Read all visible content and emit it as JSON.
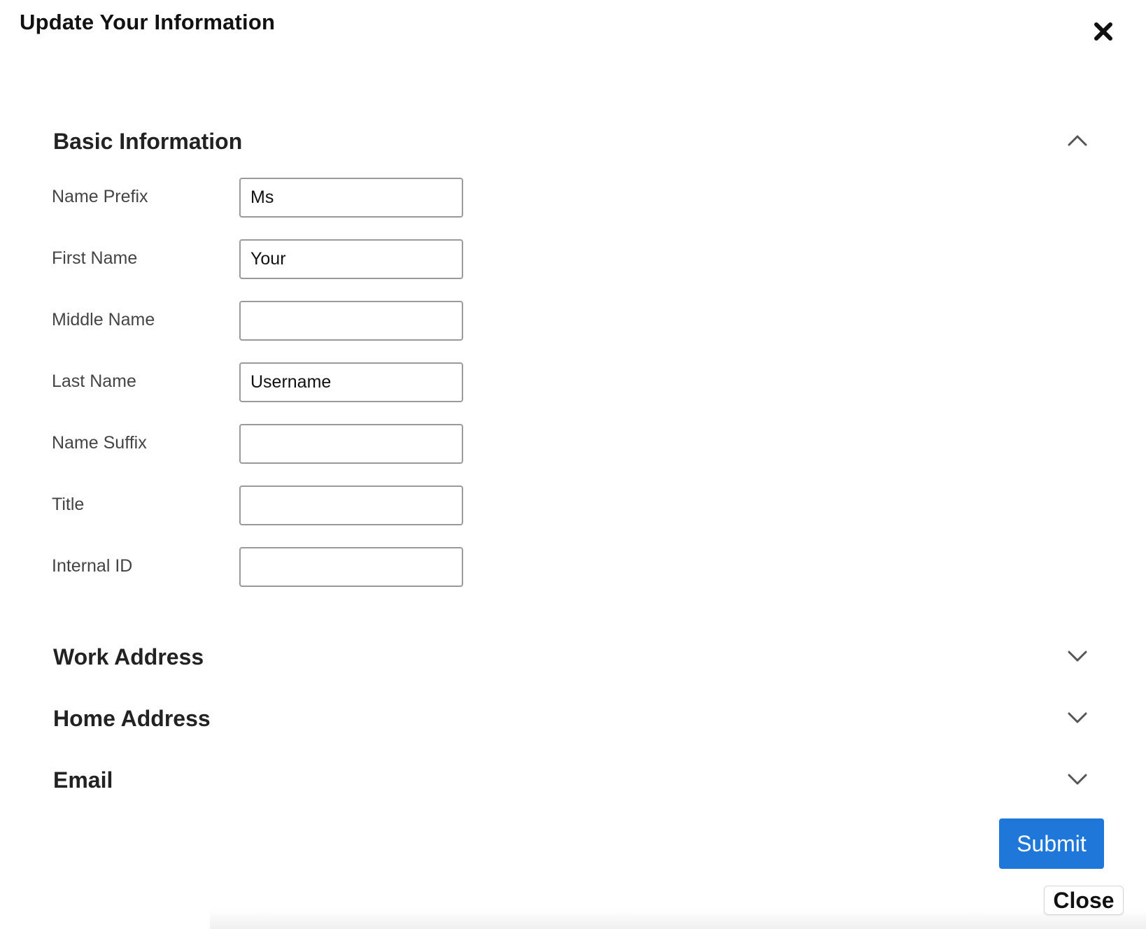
{
  "dialog": {
    "title": "Update Your Information",
    "close_icon": "close-x-icon"
  },
  "sections": {
    "basic": {
      "title": "Basic Information",
      "expanded": true,
      "icon": "chevron-up-icon",
      "fields": [
        {
          "label": "Name Prefix",
          "value": "Ms"
        },
        {
          "label": "First Name",
          "value": "Your"
        },
        {
          "label": "Middle Name",
          "value": ""
        },
        {
          "label": "Last Name",
          "value": "Username"
        },
        {
          "label": "Name Suffix",
          "value": ""
        },
        {
          "label": "Title",
          "value": ""
        },
        {
          "label": "Internal ID",
          "value": ""
        }
      ]
    },
    "work_address": {
      "title": "Work Address",
      "expanded": false,
      "icon": "chevron-down-icon"
    },
    "home_address": {
      "title": "Home Address",
      "expanded": false,
      "icon": "chevron-down-icon"
    },
    "email": {
      "title": "Email",
      "expanded": false,
      "icon": "chevron-down-icon"
    }
  },
  "actions": {
    "submit_label": "Submit",
    "close_label": "Close"
  },
  "colors": {
    "primary": "#1f77d9",
    "text": "#222222",
    "label": "#444444",
    "input_border": "#9a9a9a"
  }
}
